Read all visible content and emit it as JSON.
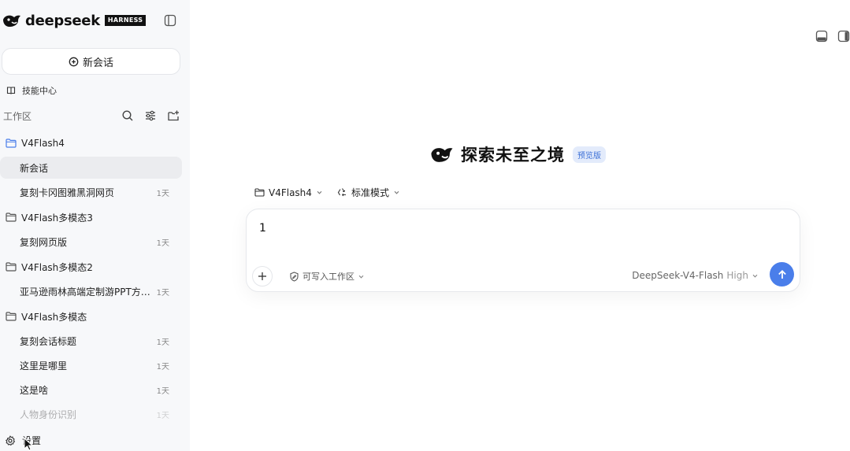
{
  "sidebar": {
    "brand": {
      "name": "deepseek",
      "badge": "HARNESS"
    },
    "new_chat_label": "新会话",
    "skills_label": "技能中心",
    "workspace_label": "工作区",
    "tree": [
      {
        "folder": "V4Flash4",
        "chats": [
          {
            "title": "新会话",
            "age": "",
            "active": true
          },
          {
            "title": "复刻卡冈图雅黑洞网页",
            "age": "1天"
          }
        ]
      },
      {
        "folder": "V4Flash多模态3",
        "chats": [
          {
            "title": "复刻网页版",
            "age": "1天"
          }
        ]
      },
      {
        "folder": "V4Flash多模态2",
        "chats": [
          {
            "title": "亚马逊雨林高端定制游PPT方…",
            "age": "1天"
          }
        ]
      },
      {
        "folder": "V4Flash多模态",
        "chats": [
          {
            "title": "复刻会话标题",
            "age": "1天"
          },
          {
            "title": "这里是哪里",
            "age": "1天"
          },
          {
            "title": "这是啥",
            "age": "1天"
          },
          {
            "title": "人物身份识别",
            "age": "1天",
            "faded": true
          }
        ]
      }
    ],
    "settings_label": "设置"
  },
  "main": {
    "hero_title": "探索未至之境",
    "hero_badge": "预览版",
    "project_selector": "V4Flash4",
    "mode_selector": "标准模式",
    "composer": {
      "text": "1",
      "write_toggle": "可写入工作区",
      "model": "DeepSeek-V4-Flash",
      "tier": "High"
    }
  },
  "colors": {
    "accent": "#4a7eea",
    "badge_bg": "#e3ebfb",
    "badge_text": "#3b6fd6",
    "sidebar_bg": "#f7f8fa"
  }
}
